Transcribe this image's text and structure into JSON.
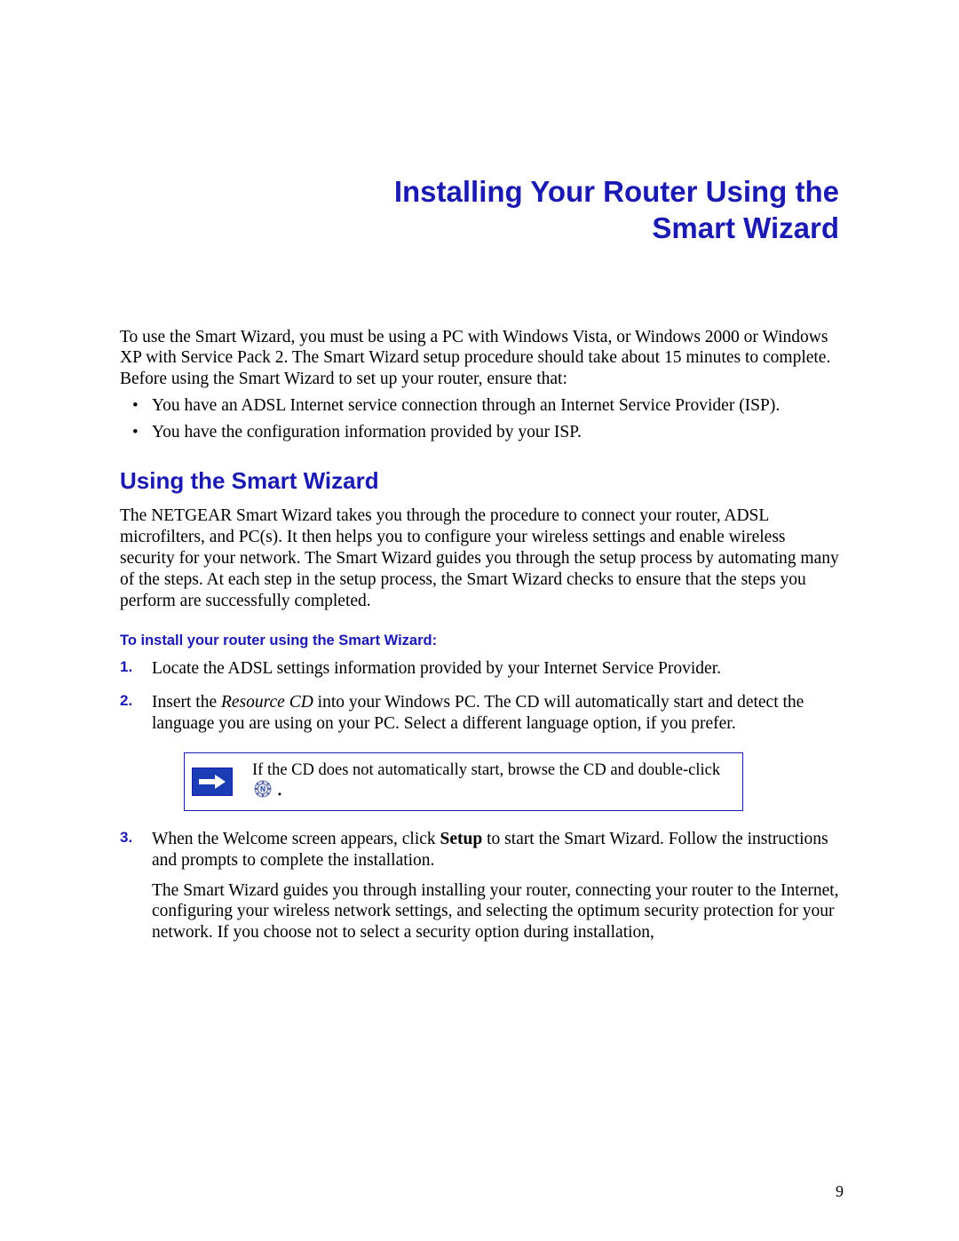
{
  "title_line1": "Installing Your Router Using the",
  "title_line2": "Smart Wizard",
  "intro": "To use the Smart Wizard, you must be using a PC with Windows Vista, or Windows 2000 or Windows XP with Service Pack 2. The Smart Wizard setup procedure should take about 15 minutes to complete. Before using the Smart Wizard to set up your router, ensure that:",
  "bullets": {
    "b1": "You have an ADSL Internet service connection through an Internet Service Provider (ISP).",
    "b2": "You have the configuration information provided by your ISP."
  },
  "section_heading": "Using the Smart Wizard",
  "section_body": "The NETGEAR Smart Wizard takes you through the procedure to connect your router, ADSL microfilters, and PC(s). It then helps you to configure your wireless settings and enable wireless security for your network. The Smart Wizard guides you through the setup process by automating many of the steps. At each step in the setup process, the Smart Wizard checks to ensure that the steps you perform are successfully completed.",
  "sub_heading": "To install your router using the Smart Wizard:",
  "steps": {
    "n1": "1.",
    "s1": "Locate the ADSL settings information provided by your Internet Service Provider.",
    "n2": "2.",
    "s2_a": "Insert the ",
    "s2_em": "Resource CD",
    "s2_b": " into your Windows PC. The CD will automatically start and detect the language you are using on your PC. Select a different language option, if you prefer.",
    "n3": "3.",
    "s3_a": "When the Welcome screen appears, click ",
    "s3_bold": "Setup",
    "s3_b": " to start the Smart Wizard. Follow the instructions and prompts to complete the installation.",
    "s3_cont": "The Smart Wizard guides you through installing your router, connecting your router to the Internet, configuring your wireless network settings, and selecting the optimum security protection for your network. If you choose not to select a security option during installation,"
  },
  "note": {
    "pre": "If the CD does not automatically start, browse the CD and double-click ",
    "post": " ."
  },
  "page_number": "9"
}
